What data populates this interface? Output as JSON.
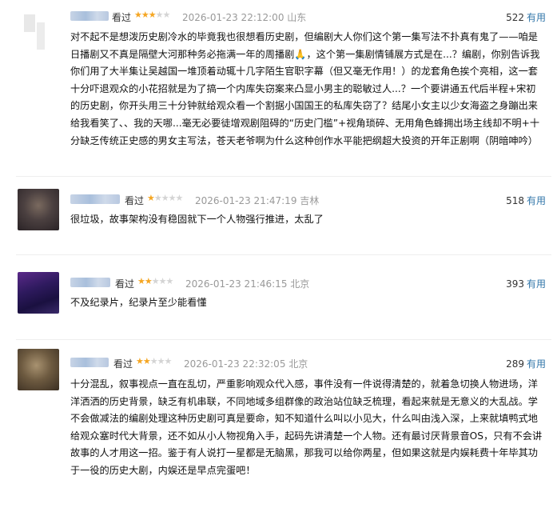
{
  "reviews": [
    {
      "status": "看过",
      "rating": 3,
      "date": "2026-01-23 22:12:00",
      "location": "山东",
      "useful_count": "522",
      "useful_label": "有用",
      "content": "对不起不是想泼历史剧冷水的毕竟我也很想看历史剧，但编剧大人你们这个第一集写法不扑真有鬼了——咱是日播剧又不真是隔壁大河那种务必拖满一年的周播剧🙏，这个第一集剧情铺展方式是在...？编剧，你别告诉我你们用了大半集让吴越国一堆顶着动辄十几字陌生官职字幕（但又毫无作用！）的龙套角色挨个亮相，这一套十分吓退观众的小花招就是为了搞一个内库失窃案来凸显小男主的聪敏过人...？一个要讲通五代后半程+宋初的历史剧，你开头用三十分钟就给观众看一个割据小国国王的私库失窃了？结尾小女主以少女海盗之身蹦出来给我看笑了、、我的天哪...毫无必要徒增观剧阻碍的“历史门槛”+视角琐碎、无用角色蜂拥出场主线却不明+十分缺乏传统正史感的男女主写法，苍天老爷啊为什么这种创作水平能把纲超大投资的开年正剧啊（阴暗呻吟）"
    },
    {
      "status": "看过",
      "rating": 1,
      "date": "2026-01-23 21:47:19",
      "location": "吉林",
      "useful_count": "518",
      "useful_label": "有用",
      "content": "很垃圾，故事架构没有稳固就下一个人物强行推进，太乱了"
    },
    {
      "status": "看过",
      "rating": 2,
      "date": "2026-01-23 21:46:15",
      "location": "北京",
      "useful_count": "393",
      "useful_label": "有用",
      "content": "不及纪录片，纪录片至少能看懂"
    },
    {
      "status": "看过",
      "rating": 2,
      "date": "2026-01-23 22:32:05",
      "location": "北京",
      "useful_count": "289",
      "useful_label": "有用",
      "content": "十分混乱，叙事视点一直在乱切，严重影响观众代入感，事件没有一件说得清楚的，就着急切换人物进场，洋洋洒洒的历史背景，缺乏有机串联，不同地域多组群像的政治站位缺乏梳理，看起来就是无意义的大乱战。学不会做减法的编剧处理这种历史剧可真是要命，知不知道什么叫以小见大，什么叫由浅入深，上来就填鸭式地给观众塞时代大背景，还不如从小人物视角入手，起码先讲清楚一个人物。还有最讨厌背景音OS，只有不会讲故事的人才用这一招。鉴于有人说打一星都是无脑黑，那我可以给你两星，但如果这就是内娱耗费十年毕其功于一役的历史大剧，内娱还是早点完蛋吧！"
    }
  ]
}
